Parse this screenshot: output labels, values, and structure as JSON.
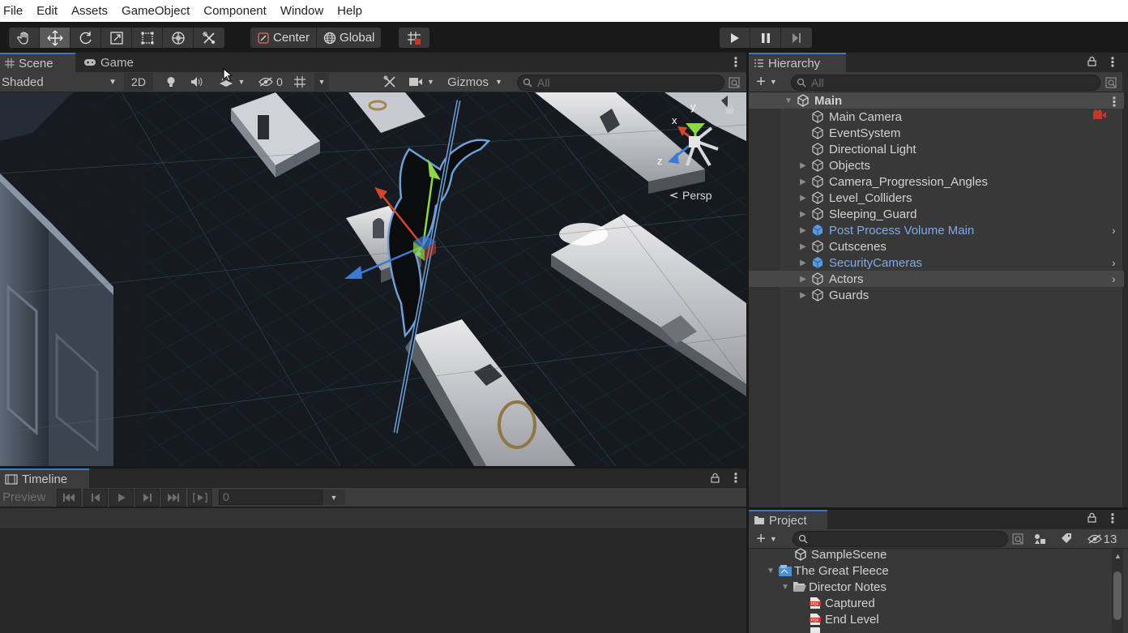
{
  "menu": [
    "File",
    "Edit",
    "Assets",
    "GameObject",
    "Component",
    "Window",
    "Help"
  ],
  "toolbar": {
    "transform_tools": [
      "hand-tool",
      "move-tool",
      "rotate-tool",
      "scale-tool",
      "rect-tool",
      "transform-tool",
      "custom-tool"
    ],
    "pivot_label": "Center",
    "space_label": "Global"
  },
  "scene": {
    "tab_scene": "Scene",
    "tab_game": "Game",
    "shading": "Shaded",
    "mode2d": "2D",
    "hidden_count": "0",
    "gizmos": "Gizmos",
    "search_placeholder": "All",
    "gizmo_persp": "Persp",
    "axis_x": "x",
    "axis_y": "y",
    "axis_z": "z"
  },
  "timeline": {
    "title": "Timeline",
    "preview": "Preview",
    "frame": "0"
  },
  "hierarchy": {
    "title": "Hierarchy",
    "search_placeholder": "All",
    "scene_name": "Main",
    "items": [
      {
        "label": "Main Camera",
        "prefab": false,
        "expandable": false
      },
      {
        "label": "EventSystem",
        "prefab": false,
        "expandable": false
      },
      {
        "label": "Directional Light",
        "prefab": false,
        "expandable": false
      },
      {
        "label": "Objects",
        "prefab": false,
        "expandable": true
      },
      {
        "label": "Camera_Progression_Angles",
        "prefab": false,
        "expandable": true
      },
      {
        "label": "Level_Colliders",
        "prefab": false,
        "expandable": true
      },
      {
        "label": "Sleeping_Guard",
        "prefab": false,
        "expandable": true
      },
      {
        "label": "Post Process Volume Main",
        "prefab": true,
        "expandable": true
      },
      {
        "label": "Cutscenes",
        "prefab": false,
        "expandable": true
      },
      {
        "label": "SecurityCameras",
        "prefab": true,
        "expandable": true
      },
      {
        "label": "Actors",
        "prefab": false,
        "expandable": true
      },
      {
        "label": "Guards",
        "prefab": false,
        "expandable": true
      }
    ]
  },
  "project": {
    "title": "Project",
    "hidden_count": "13",
    "items": [
      {
        "label": "SampleScene"
      },
      {
        "label": "The Great Fleece"
      },
      {
        "label": "Director Notes"
      },
      {
        "label": "Captured"
      },
      {
        "label": "End Level"
      }
    ]
  },
  "colors": {
    "accent_tab": "#3a79bb",
    "prefab_text": "#7cabea",
    "panel_bg": "#383838",
    "app_bg": "#191919"
  }
}
